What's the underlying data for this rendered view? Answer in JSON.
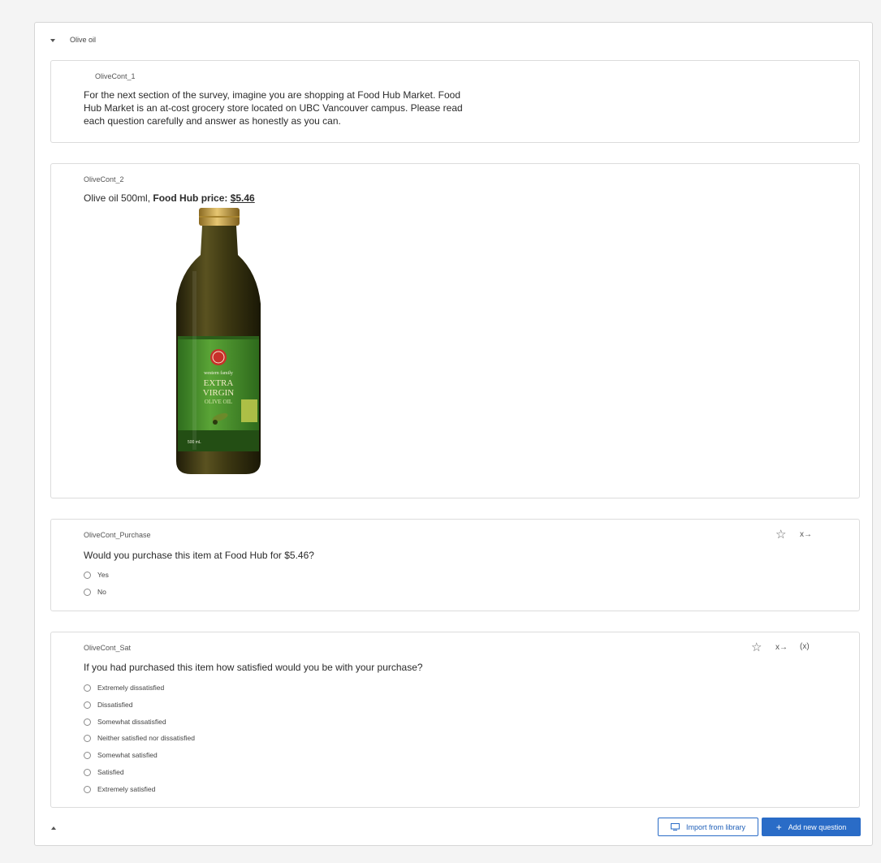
{
  "block": {
    "title": "Olive oil"
  },
  "questions": {
    "q1": {
      "id": "OliveCont_1",
      "text_lines": [
        "For the next section of the survey, imagine you are shopping at Food Hub Market. Food",
        "Hub Market is an at-cost grocery store located on UBC Vancouver campus. Please read",
        "each question carefully and answer as honestly as you can."
      ]
    },
    "q2": {
      "id": "OliveCont_2",
      "text_prefix": "Olive oil 500ml, ",
      "text_bold": "Food Hub price: ",
      "price": "$5.46",
      "image": {
        "label_brand": "western family",
        "label_line1": "EXTRA",
        "label_line2": "VIRGIN",
        "label_line3": "OLIVE OIL",
        "label_volume": "500 mL"
      }
    },
    "q3": {
      "id": "OliveCont_Purchase",
      "text": "Would you purchase this item at Food Hub for $5.46?",
      "choices": [
        "Yes",
        "No"
      ],
      "tools": {
        "skip": "x→"
      }
    },
    "q4": {
      "id": "OliveCont_Sat",
      "text": "If you had purchased this item how satisfied would you be with your purchase?",
      "choices": [
        "Extremely dissatisfied",
        "Dissatisfied",
        "Somewhat dissatisfied",
        "Neither satisfied nor dissatisfied",
        "Somewhat satisfied",
        "Satisfied",
        "Extremely satisfied"
      ],
      "tools": {
        "skip": "x→",
        "piped": "(x)"
      }
    }
  },
  "footer": {
    "import_label": "Import from library",
    "add_label": "Add new question"
  },
  "colors": {
    "accent": "#2a6cc7",
    "border": "#dcdcdc",
    "bottle_glass": "#3f3a14",
    "bottle_label": "#4f9a2e",
    "cap": "#c9a24a"
  },
  "icons": {
    "star": "star-icon",
    "library": "library-icon",
    "plus": "plus-icon"
  }
}
